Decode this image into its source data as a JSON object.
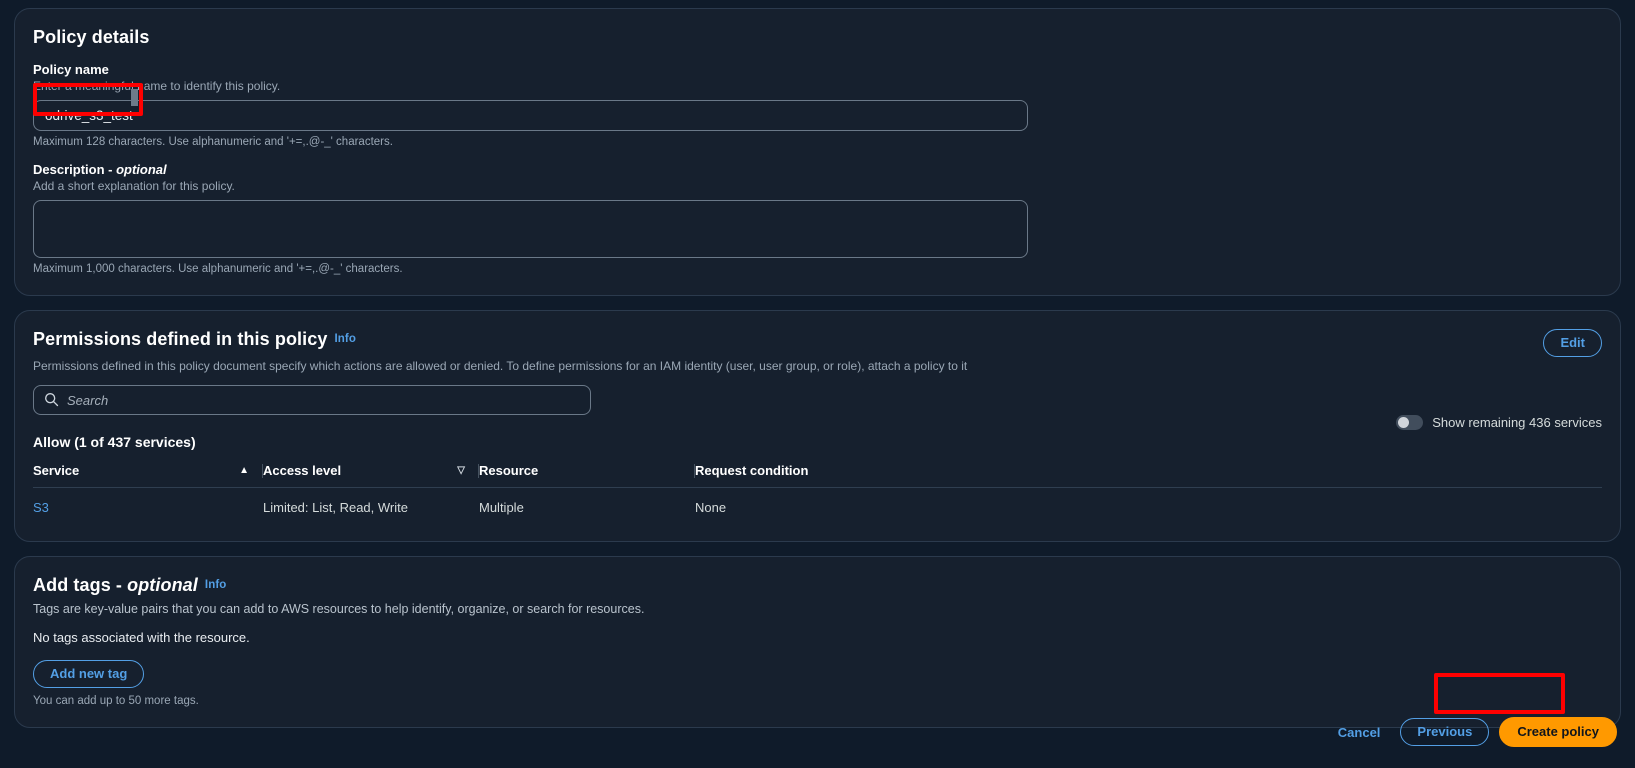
{
  "policy_details": {
    "title": "Policy details",
    "name_label": "Policy name",
    "name_hint": "Enter a meaningful name to identify this policy.",
    "name_value": "odrive_s3_test",
    "name_constraint": "Maximum 128 characters. Use alphanumeric and '+=,.@-_' characters.",
    "description_label": "Description - ",
    "description_optional": "optional",
    "description_hint": "Add a short explanation for this policy.",
    "description_value": "",
    "description_placeholder": "",
    "description_constraint": "Maximum 1,000 characters. Use alphanumeric and '+=,.@-_' characters."
  },
  "permissions": {
    "title": "Permissions defined in this policy",
    "info_label": "Info",
    "description": "Permissions defined in this policy document specify which actions are allowed or denied. To define permissions for an IAM identity (user, user group, or role), attach a policy to it",
    "edit_label": "Edit",
    "search_placeholder": "Search",
    "search_value": "",
    "toggle_label": "Show remaining 436 services",
    "toggle_state": "off",
    "allow_heading": "Allow (1 of 437 services)",
    "columns": [
      "Service",
      "Access level",
      "Resource",
      "Request condition"
    ],
    "sort_service": "▲",
    "sort_access": "▽",
    "rows": [
      {
        "service": "S3",
        "access_level": "Limited: List, Read, Write",
        "resource": "Multiple",
        "request_condition": "None"
      }
    ]
  },
  "tags": {
    "title": "Add tags - ",
    "title_optional": "optional",
    "info_label": "Info",
    "description": "Tags are key-value pairs that you can add to AWS resources to help identify, organize, or search for resources.",
    "empty_text": "No tags associated with the resource.",
    "add_button": "Add new tag",
    "limit_note": "You can add up to 50 more tags."
  },
  "footer": {
    "cancel": "Cancel",
    "previous": "Previous",
    "create": "Create policy"
  },
  "colors": {
    "background": "#0f1b2a",
    "card": "#16202e",
    "accent_link": "#539fe5",
    "primary_button": "#ff9900",
    "highlight": "#ff0000"
  }
}
